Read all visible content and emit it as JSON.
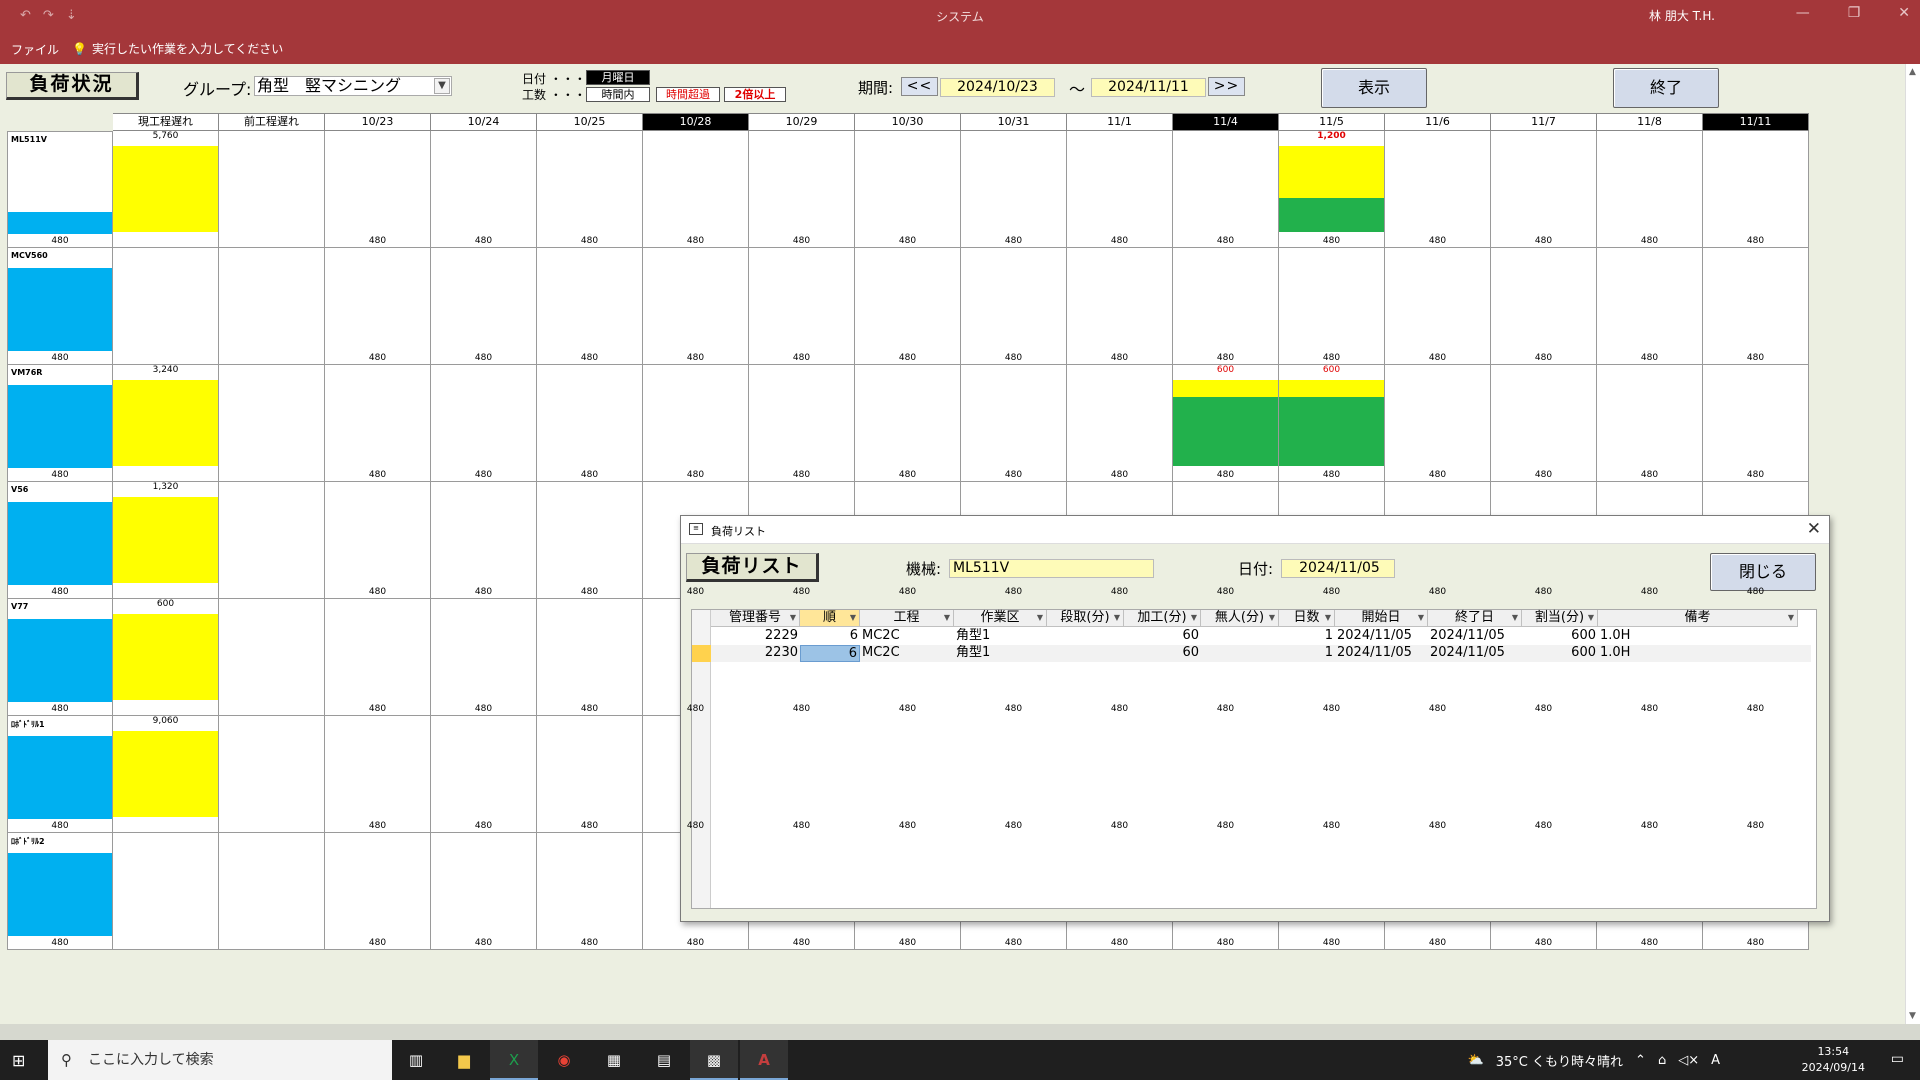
{
  "titlebar": {
    "app_title": "システム",
    "user": "林 朋大 T.H.",
    "qat": [
      "↶",
      "↷",
      "⇣"
    ],
    "win_buttons": [
      "—",
      "❐",
      "✕"
    ]
  },
  "ribbon": {
    "file_tab": "ファイル",
    "tell_me": "実行したい作業を入力してください"
  },
  "form": {
    "title": "負荷状況",
    "group_label": "グループ:",
    "group_value": "角型　竪マシニング",
    "legend": {
      "date_label": "日付 ・・・",
      "work_label": "工数 ・・・",
      "monday": "月曜日",
      "within": "時間内",
      "over": "時間超過",
      "double": "2倍以上"
    },
    "period_label": "期間:",
    "prev_btn": "<<",
    "next_btn": ">>",
    "date_from": "2024/10/23",
    "tilde": "〜",
    "date_to": "2024/11/11",
    "show_btn": "表示",
    "exit_btn": "終了"
  },
  "grid": {
    "headers": [
      "現工程遅れ",
      "前工程遅れ",
      "10/23",
      "10/24",
      "10/25",
      "10/28",
      "10/29",
      "10/30",
      "10/31",
      "11/1",
      "11/4",
      "11/5",
      "11/6",
      "11/7",
      "11/8",
      "11/11"
    ],
    "dark_headers": [
      "10/28",
      "11/4",
      "11/11"
    ],
    "capacity": "480",
    "machines": [
      {
        "name": "ML511V",
        "load_fraction": 0.27,
        "cur_delay": "5,760",
        "special": {
          "11/5": {
            "label": "1,200",
            "style": "double"
          }
        }
      },
      {
        "name": "MCV560",
        "load_fraction": 1.0,
        "cur_delay": "",
        "special": {}
      },
      {
        "name": "VM76R",
        "load_fraction": 1.0,
        "cur_delay": "3,240",
        "special": {
          "11/4": {
            "label": "600",
            "style": "over"
          },
          "11/5": {
            "label": "600",
            "style": "over"
          }
        }
      },
      {
        "name": "V56",
        "load_fraction": 1.0,
        "cur_delay": "1,320",
        "special": {}
      },
      {
        "name": "V77",
        "load_fraction": 1.0,
        "cur_delay": "600",
        "special": {}
      },
      {
        "name": "ﾛﾎﾞﾄﾞﾘﾙ1",
        "load_fraction": 1.0,
        "cur_delay": "9,060",
        "special": {}
      },
      {
        "name": "ﾛﾎﾞﾄﾞﾘﾙ2",
        "load_fraction": 1.0,
        "cur_delay": "",
        "special": {}
      }
    ]
  },
  "popup": {
    "title": "負荷リスト",
    "header": "負荷リスト",
    "machine_label": "機械:",
    "machine_value": "ML511V",
    "date_label": "日付:",
    "date_value": "2024/11/05",
    "close_btn": "閉じる",
    "columns": [
      "管理番号",
      "順",
      "工程",
      "作業区",
      "段取(分)",
      "加工(分)",
      "無人(分)",
      "日数",
      "開始日",
      "終了日",
      "割当(分)",
      "備考"
    ],
    "rows": [
      [
        "2229",
        "6",
        "MC2C",
        "角型1",
        "",
        "60",
        "",
        "1",
        "2024/11/05",
        "2024/11/05",
        "600",
        "1.0H"
      ],
      [
        "2230",
        "6",
        "MC2C",
        "角型1",
        "",
        "60",
        "",
        "1",
        "2024/11/05",
        "2024/11/05",
        "600",
        "1.0H"
      ]
    ]
  },
  "taskbar": {
    "search_placeholder": "ここに入力して検索",
    "weather": "35°C くもり時々晴れ",
    "ime": "A",
    "time": "13:54",
    "date": "2024/09/14"
  },
  "colors": {
    "titlebar": "#a4373a",
    "within": "#00b0f0",
    "over": "#ffff00",
    "double": "#22b14c"
  }
}
